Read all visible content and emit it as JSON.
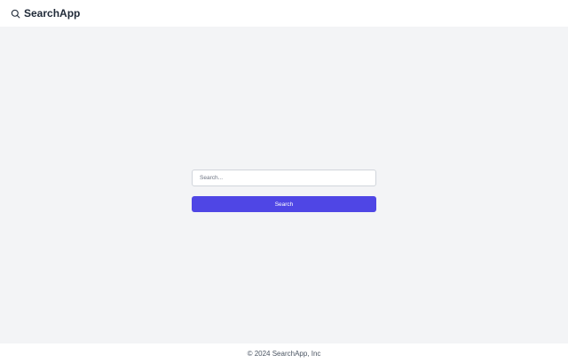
{
  "header": {
    "brand_icon": "search-icon",
    "title": "SearchApp"
  },
  "search": {
    "placeholder": "Search...",
    "value": "",
    "button_label": "Search"
  },
  "footer": {
    "text": "© 2024 SearchApp, Inc"
  },
  "colors": {
    "background": "#f3f4f6",
    "header_bg": "#ffffff",
    "accent": "#4f46e5",
    "text": "#1f2937",
    "muted": "#4b5563"
  }
}
